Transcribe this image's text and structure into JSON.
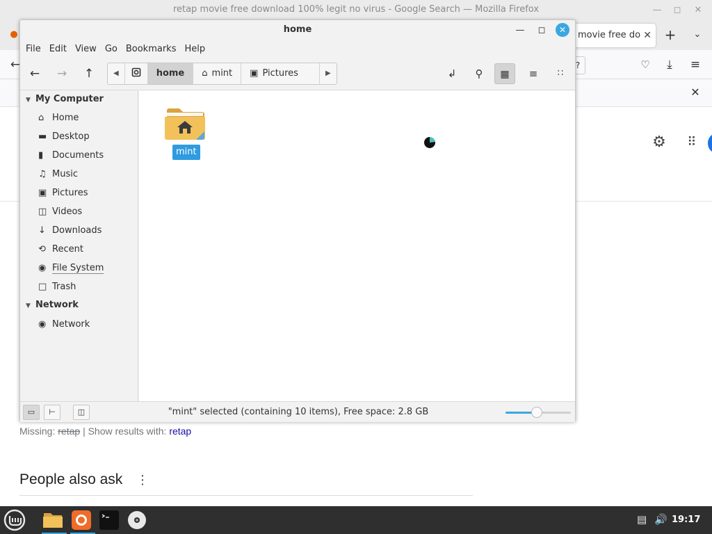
{
  "browser": {
    "window_title": "retap movie free download 100% legit no virus - Google Search — Mozilla Firefox",
    "tab_title": "movie free do",
    "missing_label": "Missing:",
    "missing_term": "retap",
    "missing_sep": "| Show results with:",
    "missing_link": "retap",
    "people_also_ask": "People also ask"
  },
  "window": {
    "title": "home",
    "close_icon": "close-icon",
    "menu": [
      "File",
      "Edit",
      "View",
      "Go",
      "Bookmarks",
      "Help"
    ],
    "path": [
      {
        "label": "home",
        "icon": "drive-icon",
        "current": true
      },
      {
        "label": "mint",
        "icon": "home-icon",
        "current": false
      },
      {
        "label": "Pictures",
        "icon": "camera-icon",
        "current": false
      }
    ],
    "sidebar": {
      "sections": [
        {
          "label": "My Computer",
          "items": [
            {
              "label": "Home",
              "icon": "home-icon"
            },
            {
              "label": "Desktop",
              "icon": "desktop-icon"
            },
            {
              "label": "Documents",
              "icon": "document-icon"
            },
            {
              "label": "Music",
              "icon": "music-icon"
            },
            {
              "label": "Pictures",
              "icon": "camera-icon"
            },
            {
              "label": "Videos",
              "icon": "film-icon"
            },
            {
              "label": "Downloads",
              "icon": "download-icon"
            },
            {
              "label": "Recent",
              "icon": "recent-icon"
            },
            {
              "label": "File System",
              "icon": "drive-icon"
            },
            {
              "label": "Trash",
              "icon": "trash-icon"
            }
          ]
        },
        {
          "label": "Network",
          "items": [
            {
              "label": "Network",
              "icon": "globe-icon"
            }
          ]
        }
      ]
    },
    "content": {
      "items": [
        {
          "label": "mint",
          "icon": "home-folder-icon",
          "selected": true
        }
      ]
    },
    "status": "\"mint\" selected (containing 10 items), Free space: 2.8 GB",
    "zoom_level": 0.48
  },
  "taskbar": {
    "clock": "19:17",
    "apps": [
      "menu",
      "files",
      "firefox",
      "terminal",
      "disc"
    ]
  },
  "colors": {
    "accent": "#3aa8df",
    "selection": "#2f9be0",
    "folder": "#f2c15a",
    "taskbar": "#2f2f2f"
  }
}
